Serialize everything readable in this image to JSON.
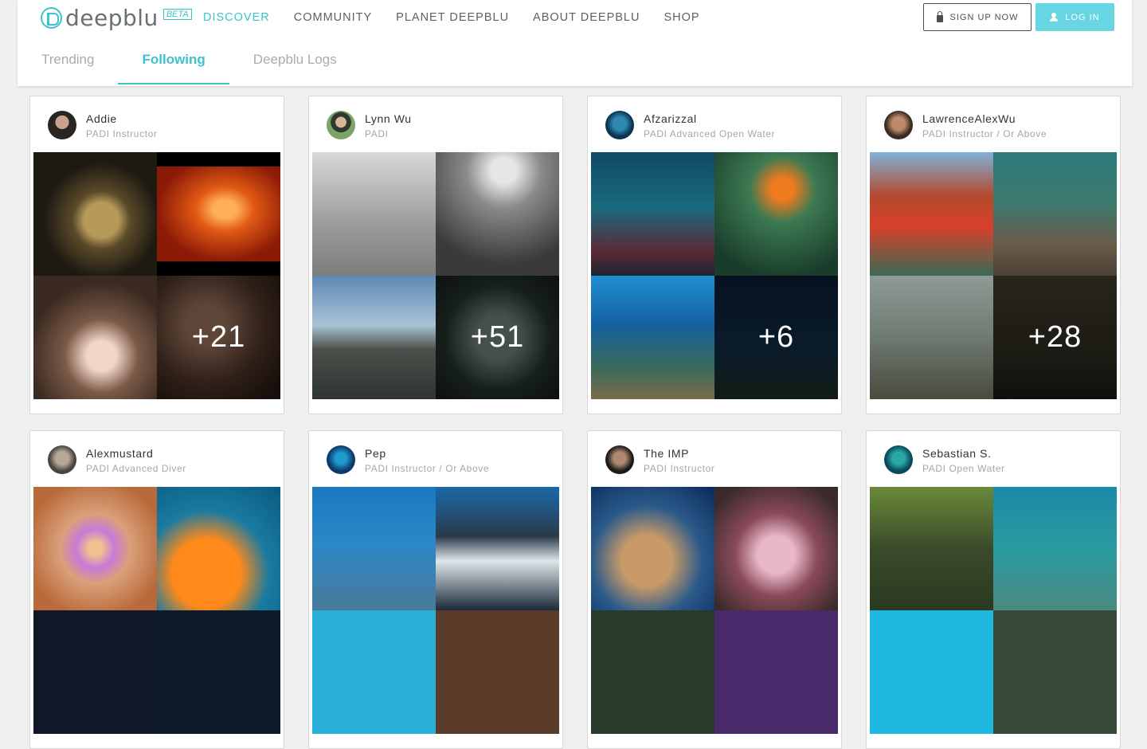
{
  "brand": {
    "name": "deepblu",
    "badge": "BETA"
  },
  "nav": [
    {
      "label": "DISCOVER"
    },
    {
      "label": "COMMUNITY"
    },
    {
      "label": "PLANET DEEPBLU"
    },
    {
      "label": "ABOUT DEEPBLU"
    },
    {
      "label": "SHOP"
    }
  ],
  "auth": {
    "signup": "SIGN UP NOW",
    "login": "LOG IN"
  },
  "tabs": [
    {
      "label": "Trending"
    },
    {
      "label": "Following"
    },
    {
      "label": "Deepblu Logs"
    }
  ],
  "colors": {
    "accent": "#3ec1cf",
    "login_bg": "#67d6e2"
  },
  "cards": [
    {
      "name": "Addie",
      "cert": "PADI Instructor",
      "more": "+21"
    },
    {
      "name": "Lynn Wu",
      "cert": "PADI",
      "more": "+51"
    },
    {
      "name": "Afzarizzal",
      "cert": "PADI Advanced Open Water",
      "more": "+6"
    },
    {
      "name": "LawrenceAlexWu",
      "cert": "PADI Instructor / Or Above",
      "more": "+28"
    },
    {
      "name": "Alexmustard",
      "cert": "PADI Advanced Diver",
      "more": ""
    },
    {
      "name": "Pep",
      "cert": "PADI Instructor / Or Above",
      "more": ""
    },
    {
      "name": "The IMP",
      "cert": "PADI Instructor",
      "more": ""
    },
    {
      "name": "Sebastian S.",
      "cert": "PADI Open Water",
      "more": ""
    }
  ]
}
